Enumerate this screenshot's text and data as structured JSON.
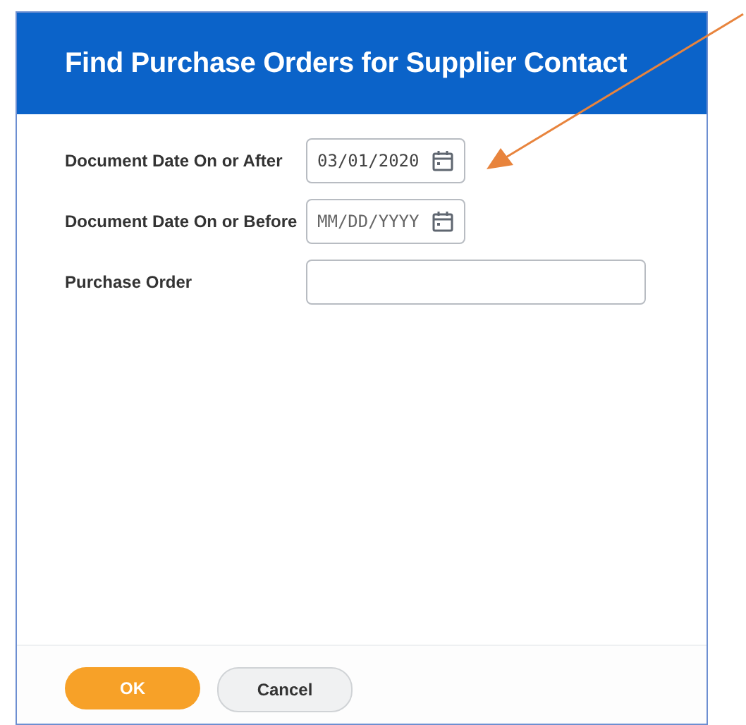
{
  "dialog": {
    "title": "Find Purchase Orders for Supplier Contact"
  },
  "fields": [
    {
      "label": "Document Date On or After",
      "kind": "date",
      "value": "03/01/2020"
    },
    {
      "label": "Document Date On or Before",
      "kind": "date",
      "placeholder": "MM/DD/YYYY"
    },
    {
      "label": "Purchase Order",
      "kind": "text"
    }
  ],
  "buttons": [
    {
      "label": "OK",
      "kind": "primary"
    },
    {
      "label": "Cancel",
      "kind": "secondary"
    }
  ]
}
